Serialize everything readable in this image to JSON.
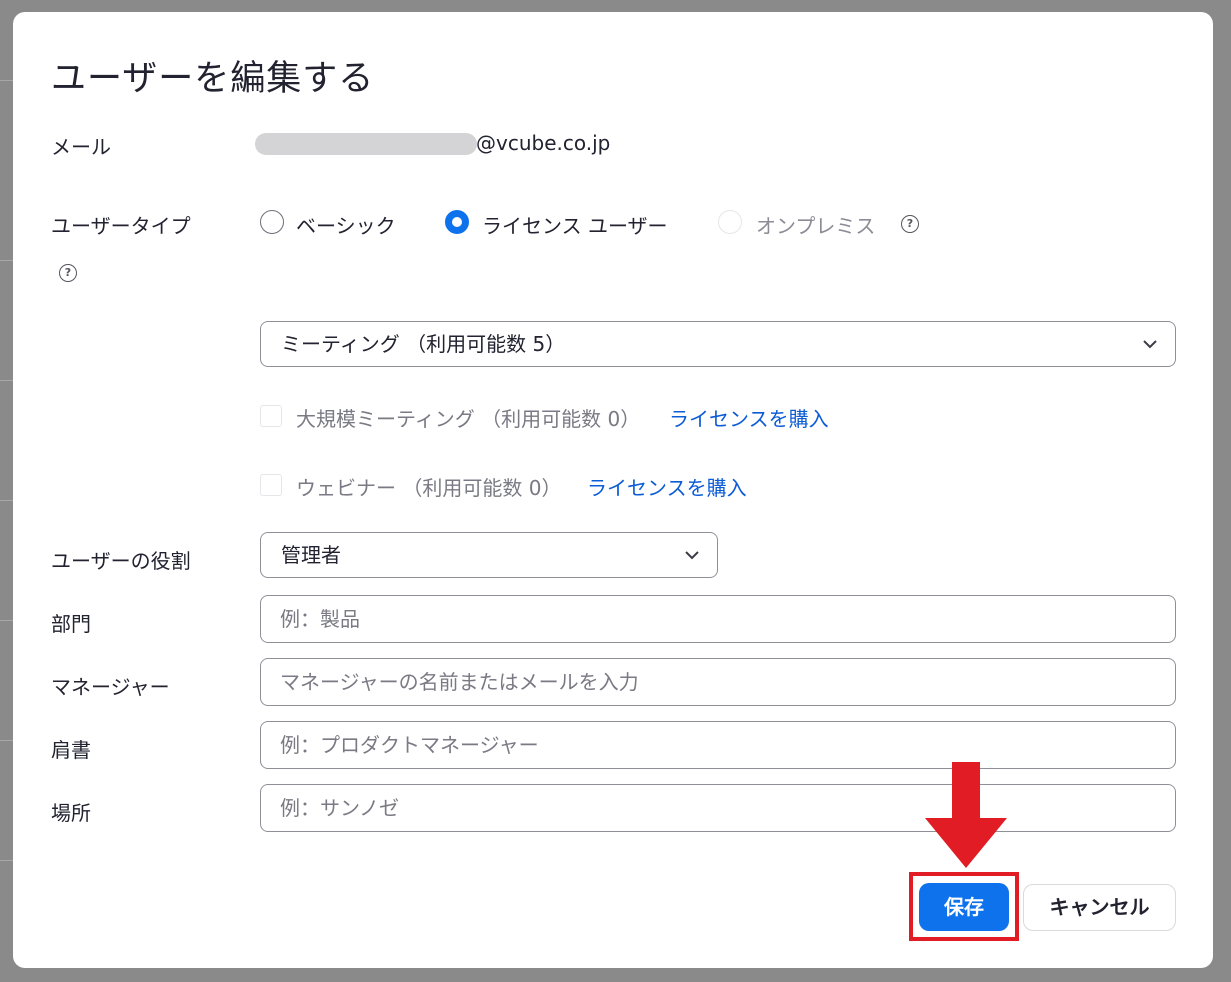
{
  "dialog": {
    "title": "ユーザーを編集する",
    "email": {
      "label": "メール",
      "domain": "@vcube.co.jp"
    },
    "user_type": {
      "label": "ユーザータイプ",
      "options": [
        {
          "label": "ベーシック",
          "checked": false,
          "disabled": false
        },
        {
          "label": "ライセンス ユーザー",
          "checked": true,
          "disabled": false
        },
        {
          "label": "オンプレミス",
          "checked": false,
          "disabled": true
        }
      ],
      "help_icon": "question-circle-icon"
    },
    "license_select": {
      "value": "ミーティング （利用可能数 5）"
    },
    "addons": [
      {
        "label": "大規模ミーティング （利用可能数 0）",
        "link": "ライセンスを購入",
        "checked": false
      },
      {
        "label": "ウェビナー （利用可能数 0）",
        "link": "ライセンスを購入",
        "checked": false
      }
    ],
    "role": {
      "label": "ユーザーの役割",
      "value": "管理者"
    },
    "department": {
      "label": "部門",
      "placeholder": "例：製品"
    },
    "manager": {
      "label": "マネージャー",
      "placeholder": "マネージャーの名前またはメールを入力"
    },
    "job_title": {
      "label": "肩書",
      "placeholder": "例：プロダクトマネージャー"
    },
    "location": {
      "label": "場所",
      "placeholder": "例：サンノゼ"
    },
    "buttons": {
      "save": "保存",
      "cancel": "キャンセル"
    }
  },
  "colors": {
    "primary": "#0e72ed",
    "link": "#0b5cd5",
    "annotation": "#e11c24"
  }
}
